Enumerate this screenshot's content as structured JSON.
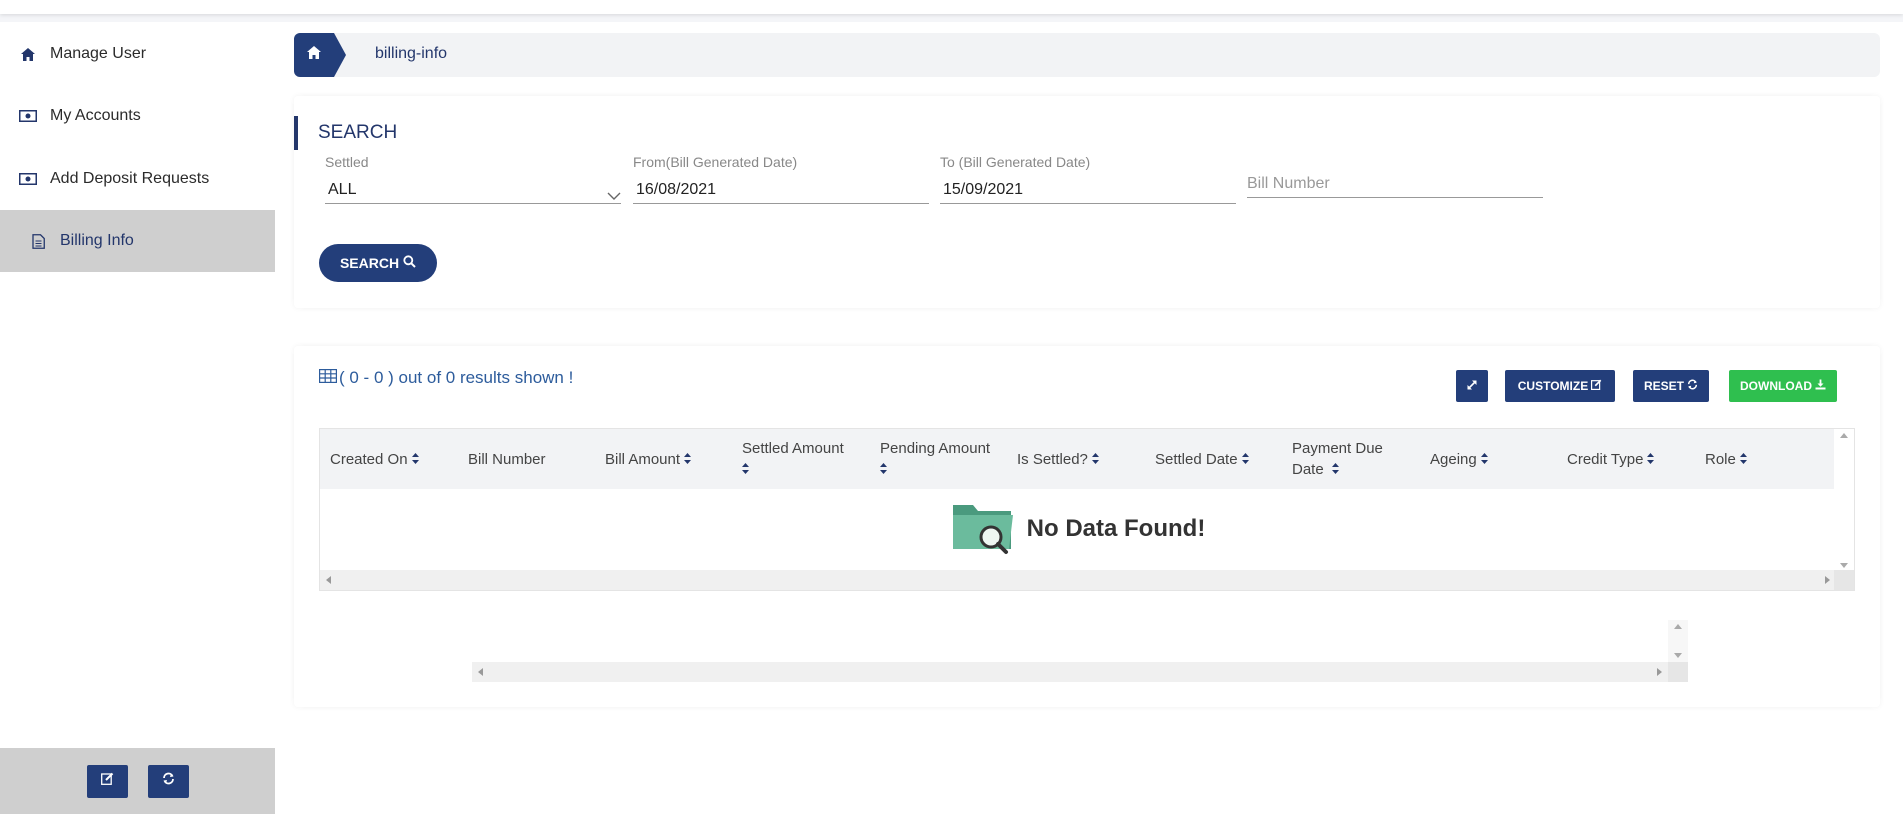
{
  "sidebar": {
    "items": [
      {
        "label": "Manage User",
        "icon": "home-icon"
      },
      {
        "label": "My Accounts",
        "icon": "money-icon"
      },
      {
        "label": "Add Deposit Requests",
        "icon": "money-icon"
      },
      {
        "label": "Billing Info",
        "icon": "document-icon",
        "active": true
      }
    ],
    "footer_buttons": [
      "edit-icon",
      "refresh-icon"
    ]
  },
  "breadcrumb": {
    "home_icon": "home-icon",
    "current": "billing-info"
  },
  "search": {
    "title": "SEARCH",
    "settled": {
      "label": "Settled",
      "value": "ALL"
    },
    "from_date": {
      "label": "From(Bill Generated Date)",
      "value": "16/08/2021"
    },
    "to_date": {
      "label": "To (Bill Generated Date)",
      "value": "15/09/2021"
    },
    "bill_number": {
      "placeholder": "Bill Number"
    },
    "button_label": "SEARCH"
  },
  "results": {
    "summary": "( 0 - 0 ) out of 0 results shown !",
    "buttons": {
      "customize": "CUSTOMIZE",
      "reset": "RESET",
      "download": "DOWNLOAD"
    },
    "columns": [
      {
        "label": "Created On",
        "sortable": true
      },
      {
        "label": "Bill Number",
        "sortable": false
      },
      {
        "label": "Bill Amount",
        "sortable": true
      },
      {
        "label": "Settled Amount",
        "sortable": true
      },
      {
        "label": "Pending Amount",
        "sortable": true
      },
      {
        "label": "Is Settled?",
        "sortable": true
      },
      {
        "label": "Settled Date",
        "sortable": true
      },
      {
        "label": "Payment Due Date",
        "sortable": true
      },
      {
        "label": "Ageing",
        "sortable": true
      },
      {
        "label": "Credit Type",
        "sortable": true
      },
      {
        "label": "Role",
        "sortable": true
      }
    ],
    "empty_text": "No Data Found!"
  },
  "colors": {
    "primary": "#233e7a",
    "download": "#2fbf4f",
    "active_bg": "#cfcfcf"
  }
}
